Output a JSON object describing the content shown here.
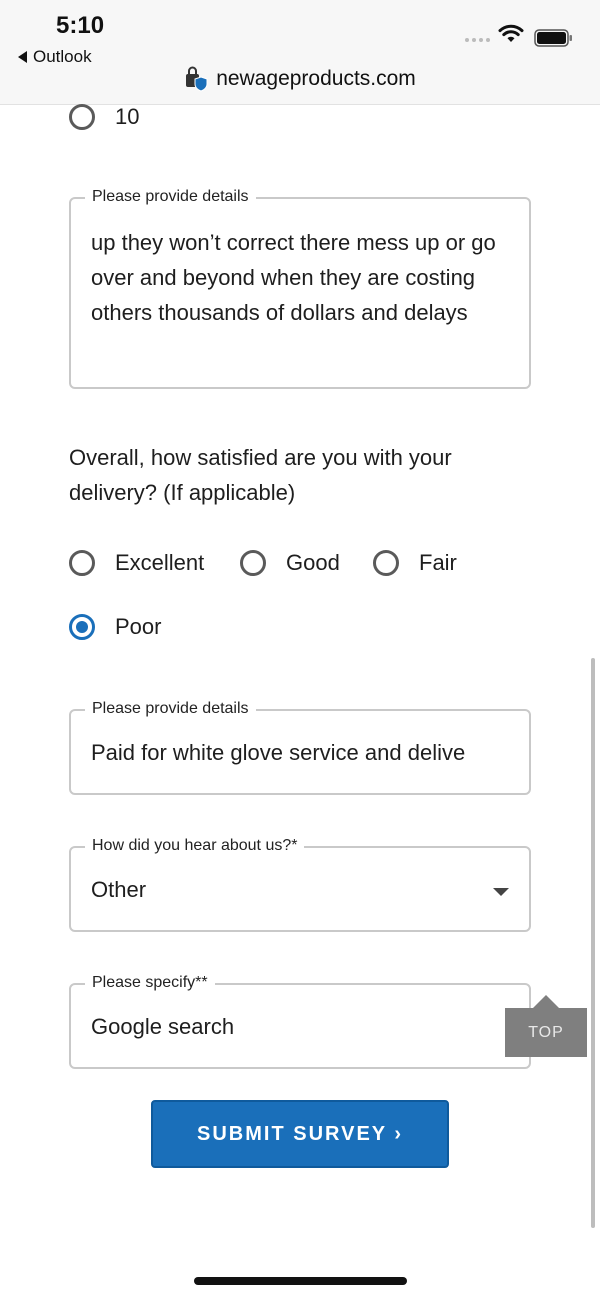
{
  "status_bar": {
    "time": "5:10",
    "back_app": "Outlook",
    "url": "newageproducts.com"
  },
  "rating": {
    "last_option": "10",
    "last_option_selected": false
  },
  "details_1": {
    "legend": "Please provide details",
    "value": "up they won’t correct there mess up or go over and beyond when they are costing others thousands of dollars and delays"
  },
  "delivery": {
    "question": "Overall, how satisfied are you with your delivery? (If applicable)",
    "options": [
      "Excellent",
      "Good",
      "Fair",
      "Poor"
    ],
    "selected": "Poor"
  },
  "details_2": {
    "legend": "Please provide details",
    "value": "Paid for white glove service and delive"
  },
  "heard_about": {
    "legend": "How did you hear about us?*",
    "value": "Other"
  },
  "specify": {
    "legend": "Please specify**",
    "value": "Google search"
  },
  "top_button": "TOP",
  "submit_label": "SUBMIT SURVEY ›",
  "colors": {
    "accent": "#1a6fba",
    "top_button_bg": "#7f7f7f"
  }
}
